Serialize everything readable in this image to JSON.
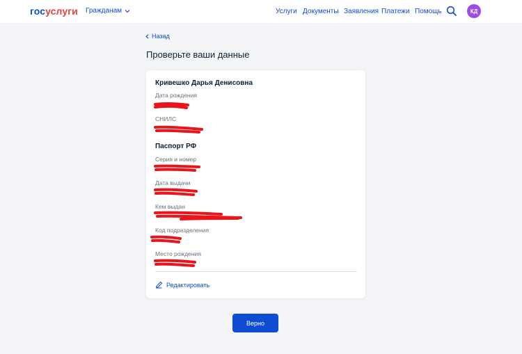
{
  "header": {
    "logo_gos": "гос",
    "logo_uslugi": "услуги",
    "audience": "Гражданам",
    "nav": [
      "Услуги",
      "Документы",
      "Заявления",
      "Платежи",
      "Помощь"
    ],
    "avatar_initials": "КД",
    "icons": {
      "search": "search-icon",
      "chevron": "chevron-down-icon"
    }
  },
  "back_link": "Назад",
  "page_title": "Проверьте ваши данные",
  "card": {
    "full_name": "Кривешко Дарья Денисовна",
    "birth_date_label": "Дата рождения",
    "snils_label": "СНИЛС",
    "passport_title": "Паспорт РФ",
    "series_number_label": "Серия и номер",
    "issue_date_label": "Дата выдачи",
    "issued_by_label": "Кем выдан",
    "department_code_label": "Код подразделения",
    "birth_place_label": "Место рождения",
    "edit_label": "Редактировать"
  },
  "confirm_button": "Верно",
  "colors": {
    "accent": "#0d4cd3",
    "logo_red": "#e4433c",
    "avatar": "#9e4ce8",
    "redaction": "#e8151b",
    "background": "#f4f5f8"
  }
}
